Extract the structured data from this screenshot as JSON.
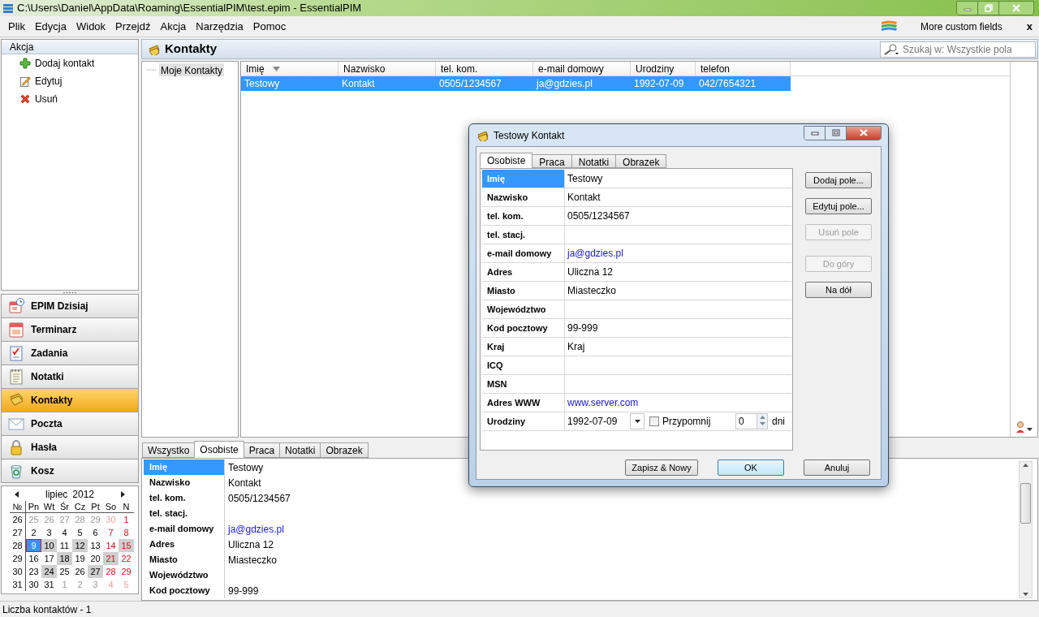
{
  "window": {
    "title": "C:\\Users\\Daniel\\AppData\\Roaming\\EssentialPIM\\test.epim - EssentialPIM"
  },
  "menu": [
    "Plik",
    "Edycja",
    "Widok",
    "Przejdź",
    "Akcja",
    "Narzędzia",
    "Pomoc"
  ],
  "promo": {
    "label": "More custom fields",
    "close": "x"
  },
  "actions": {
    "title": "Akcja",
    "items": [
      "Dodaj kontakt",
      "Edytuj",
      "Usuń"
    ]
  },
  "nav": [
    {
      "label": "EPIM Dzisiaj",
      "selected": false
    },
    {
      "label": "Terminarz",
      "selected": false
    },
    {
      "label": "Zadania",
      "selected": false
    },
    {
      "label": "Notatki",
      "selected": false
    },
    {
      "label": "Kontakty",
      "selected": true
    },
    {
      "label": "Poczta",
      "selected": false
    },
    {
      "label": "Hasła",
      "selected": false
    },
    {
      "label": "Kosz",
      "selected": false
    }
  ],
  "calendar": {
    "month": "lipiec",
    "year": "2012",
    "week_header": "№",
    "weekdays": [
      "Pn",
      "Wt",
      "Śr",
      "Cz",
      "Pt",
      "So",
      "N"
    ],
    "weeks": [
      {
        "number": "26",
        "days": [
          {
            "day": "25",
            "other_month": true,
            "marked": false,
            "selected": false
          },
          {
            "day": "26",
            "other_month": true,
            "marked": false,
            "selected": false
          },
          {
            "day": "27",
            "other_month": true,
            "marked": false,
            "selected": false
          },
          {
            "day": "28",
            "other_month": true,
            "marked": false,
            "selected": false
          },
          {
            "day": "29",
            "other_month": true,
            "marked": false,
            "selected": false
          },
          {
            "day": "30",
            "other_month": true,
            "marked": false,
            "selected": false
          },
          {
            "day": "1",
            "other_month": false,
            "marked": false,
            "selected": false
          }
        ]
      },
      {
        "number": "27",
        "days": [
          {
            "day": "2",
            "other_month": false,
            "marked": false,
            "selected": false
          },
          {
            "day": "3",
            "other_month": false,
            "marked": false,
            "selected": false
          },
          {
            "day": "4",
            "other_month": false,
            "marked": false,
            "selected": false
          },
          {
            "day": "5",
            "other_month": false,
            "marked": false,
            "selected": false
          },
          {
            "day": "6",
            "other_month": false,
            "marked": false,
            "selected": false
          },
          {
            "day": "7",
            "other_month": false,
            "marked": false,
            "selected": false
          },
          {
            "day": "8",
            "other_month": false,
            "marked": false,
            "selected": false
          }
        ]
      },
      {
        "number": "28",
        "days": [
          {
            "day": "9",
            "other_month": false,
            "marked": false,
            "selected": true
          },
          {
            "day": "10",
            "other_month": false,
            "marked": true,
            "selected": false
          },
          {
            "day": "11",
            "other_month": false,
            "marked": false,
            "selected": false
          },
          {
            "day": "12",
            "other_month": false,
            "marked": true,
            "selected": false
          },
          {
            "day": "13",
            "other_month": false,
            "marked": false,
            "selected": false
          },
          {
            "day": "14",
            "other_month": false,
            "marked": false,
            "selected": false
          },
          {
            "day": "15",
            "other_month": false,
            "marked": true,
            "selected": false
          }
        ]
      },
      {
        "number": "29",
        "days": [
          {
            "day": "16",
            "other_month": false,
            "marked": false,
            "selected": false
          },
          {
            "day": "17",
            "other_month": false,
            "marked": false,
            "selected": false
          },
          {
            "day": "18",
            "other_month": false,
            "marked": true,
            "selected": false
          },
          {
            "day": "19",
            "other_month": false,
            "marked": false,
            "selected": false
          },
          {
            "day": "20",
            "other_month": false,
            "marked": false,
            "selected": false
          },
          {
            "day": "21",
            "other_month": false,
            "marked": true,
            "selected": false
          },
          {
            "day": "22",
            "other_month": false,
            "marked": false,
            "selected": false
          }
        ]
      },
      {
        "number": "30",
        "days": [
          {
            "day": "23",
            "other_month": false,
            "marked": false,
            "selected": false
          },
          {
            "day": "24",
            "other_month": false,
            "marked": true,
            "selected": false
          },
          {
            "day": "25",
            "other_month": false,
            "marked": false,
            "selected": false
          },
          {
            "day": "26",
            "other_month": false,
            "marked": false,
            "selected": false
          },
          {
            "day": "27",
            "other_month": false,
            "marked": true,
            "selected": false
          },
          {
            "day": "28",
            "other_month": false,
            "marked": false,
            "selected": false
          },
          {
            "day": "29",
            "other_month": false,
            "marked": false,
            "selected": false
          }
        ]
      },
      {
        "number": "31",
        "days": [
          {
            "day": "30",
            "other_month": false,
            "marked": false,
            "selected": false
          },
          {
            "day": "31",
            "other_month": false,
            "marked": false,
            "selected": false
          },
          {
            "day": "1",
            "other_month": true,
            "marked": false,
            "selected": false
          },
          {
            "day": "2",
            "other_month": true,
            "marked": false,
            "selected": false
          },
          {
            "day": "3",
            "other_month": true,
            "marked": false,
            "selected": false
          },
          {
            "day": "4",
            "other_month": true,
            "marked": false,
            "selected": false
          },
          {
            "day": "5",
            "other_month": true,
            "marked": false,
            "selected": false
          }
        ]
      }
    ]
  },
  "module": {
    "title": "Kontakty",
    "search_placeholder": "Szukaj w: Wszystkie pola"
  },
  "tree": [
    {
      "label": "Moje Kontakty",
      "selected": true
    }
  ],
  "table": {
    "columns": [
      {
        "label": "Imię",
        "sorted": true
      },
      {
        "label": "Nazwisko",
        "sorted": false
      },
      {
        "label": "tel. kom.",
        "sorted": false
      },
      {
        "label": "e-mail domowy",
        "sorted": false
      },
      {
        "label": "Urodziny",
        "sorted": false
      },
      {
        "label": "telefon",
        "sorted": false
      }
    ],
    "rows": [
      {
        "cells": [
          "Testowy",
          "Kontakt",
          "0505/1234567",
          "ja@gdzies.pl",
          "1992-07-09",
          "042/7654321"
        ],
        "selected": true
      }
    ]
  },
  "dialog": {
    "title": "Testowy Kontakt",
    "tabs": [
      {
        "label": "Osobiste",
        "selected": true
      },
      {
        "label": "Praca",
        "selected": false
      },
      {
        "label": "Notatki",
        "selected": false
      },
      {
        "label": "Obrazek",
        "selected": false
      }
    ],
    "fields": [
      {
        "label": "Imię",
        "value": "Testowy",
        "kind": "text",
        "selected": true
      },
      {
        "label": "Nazwisko",
        "value": "Kontakt",
        "kind": "text",
        "selected": false
      },
      {
        "label": "tel. kom.",
        "value": "0505/1234567",
        "kind": "text",
        "selected": false
      },
      {
        "label": "tel. stacj.",
        "kind": "text",
        "selected": false
      },
      {
        "label": "e-mail domowy",
        "value": "ja@gdzies.pl",
        "kind": "link",
        "selected": false
      },
      {
        "label": "Adres",
        "value": "Uliczna 12",
        "kind": "text",
        "selected": false
      },
      {
        "label": "Miasto",
        "value": "Miasteczko",
        "kind": "text",
        "selected": false
      },
      {
        "label": "Województwo",
        "kind": "text",
        "selected": false
      },
      {
        "label": "Kod pocztowy",
        "value": "99-999",
        "kind": "text",
        "selected": false
      },
      {
        "label": "Kraj",
        "value": "Kraj",
        "kind": "text",
        "selected": false
      },
      {
        "label": "ICQ",
        "kind": "text",
        "selected": false
      },
      {
        "label": "MSN",
        "kind": "text",
        "selected": false
      },
      {
        "label": "Adres WWW",
        "value": "www.server.com",
        "kind": "link",
        "selected": false
      },
      {
        "label": "Urodziny",
        "value": "1992-07-09",
        "kind": "date",
        "selected": false,
        "reminder": {
          "label": "Przypomnij",
          "checked": false
        },
        "days_value": "0",
        "days_unit": "dni"
      }
    ],
    "side_buttons": [
      {
        "label": "Dodaj pole...",
        "disabled": false
      },
      {
        "label": "Edytuj pole...",
        "disabled": false
      },
      {
        "label": "Usuń pole",
        "disabled": true
      },
      {
        "label": "Do góry",
        "disabled": true
      },
      {
        "label": "Na dół",
        "disabled": false
      }
    ],
    "buttons": [
      {
        "label": "Zapisz & Nowy",
        "default": false
      },
      {
        "label": "OK",
        "default": true
      },
      {
        "label": "Anuluj",
        "default": false
      }
    ]
  },
  "details": {
    "tabs": [
      {
        "label": "Wszystko",
        "selected": false
      },
      {
        "label": "Osobiste",
        "selected": true
      },
      {
        "label": "Praca",
        "selected": false
      },
      {
        "label": "Notatki",
        "selected": false
      },
      {
        "label": "Obrazek",
        "selected": false
      }
    ],
    "fields": [
      {
        "label": "Imię",
        "value": "Testowy",
        "kind": "text",
        "selected": true
      },
      {
        "label": "Nazwisko",
        "value": "Kontakt",
        "kind": "text",
        "selected": false
      },
      {
        "label": "tel. kom.",
        "value": "0505/1234567",
        "kind": "text",
        "selected": false
      },
      {
        "label": "tel. stacj.",
        "kind": "text",
        "selected": false
      },
      {
        "label": "e-mail domowy",
        "value": "ja@gdzies.pl",
        "kind": "link",
        "selected": false
      },
      {
        "label": "Adres",
        "value": "Uliczna 12",
        "kind": "text",
        "selected": false
      },
      {
        "label": "Miasto",
        "value": "Miasteczko",
        "kind": "text",
        "selected": false
      },
      {
        "label": "Województwo",
        "kind": "text",
        "selected": false
      },
      {
        "label": "Kod pocztowy",
        "value": "99-999",
        "kind": "text",
        "selected": false
      }
    ]
  },
  "status_bar": "Liczba kontaktów - 1"
}
